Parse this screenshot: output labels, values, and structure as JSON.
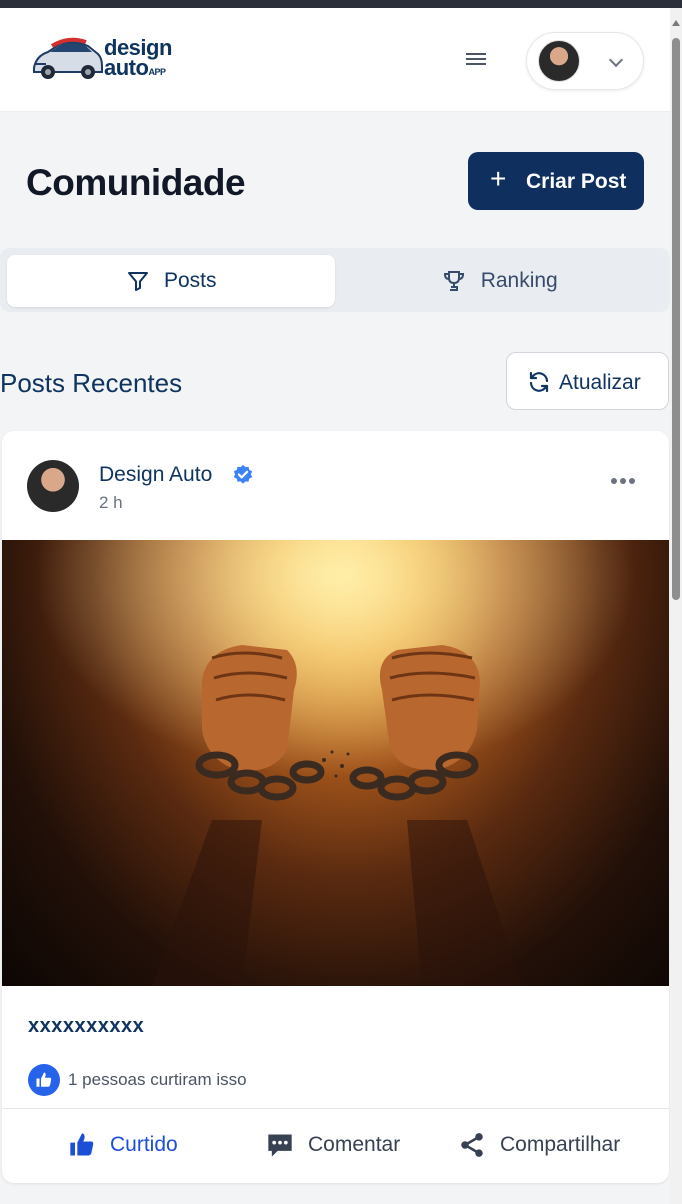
{
  "header": {
    "logo_line1": "design",
    "logo_line2": "auto",
    "logo_suffix": "APP"
  },
  "page": {
    "title": "Comunidade",
    "create_button": "Criar Post",
    "create_icon": "+"
  },
  "tabs": [
    {
      "label": "Posts",
      "icon": "filter-icon",
      "active": true
    },
    {
      "label": "Ranking",
      "icon": "trophy-icon",
      "active": false
    }
  ],
  "section": {
    "title": "Posts Recentes",
    "refresh_button": "Atualizar"
  },
  "post": {
    "author": "Design Auto",
    "verified": true,
    "time": "2 h",
    "caption": "xxxxxxxxxx",
    "likes_text": "1 pessoas curtiram isso",
    "actions": {
      "like": "Curtido",
      "comment": "Comentar",
      "share": "Compartilhar"
    }
  },
  "colors": {
    "primary": "#0f2f5f",
    "accent_blue": "#1d4ed8",
    "background": "#f3f4f6"
  }
}
